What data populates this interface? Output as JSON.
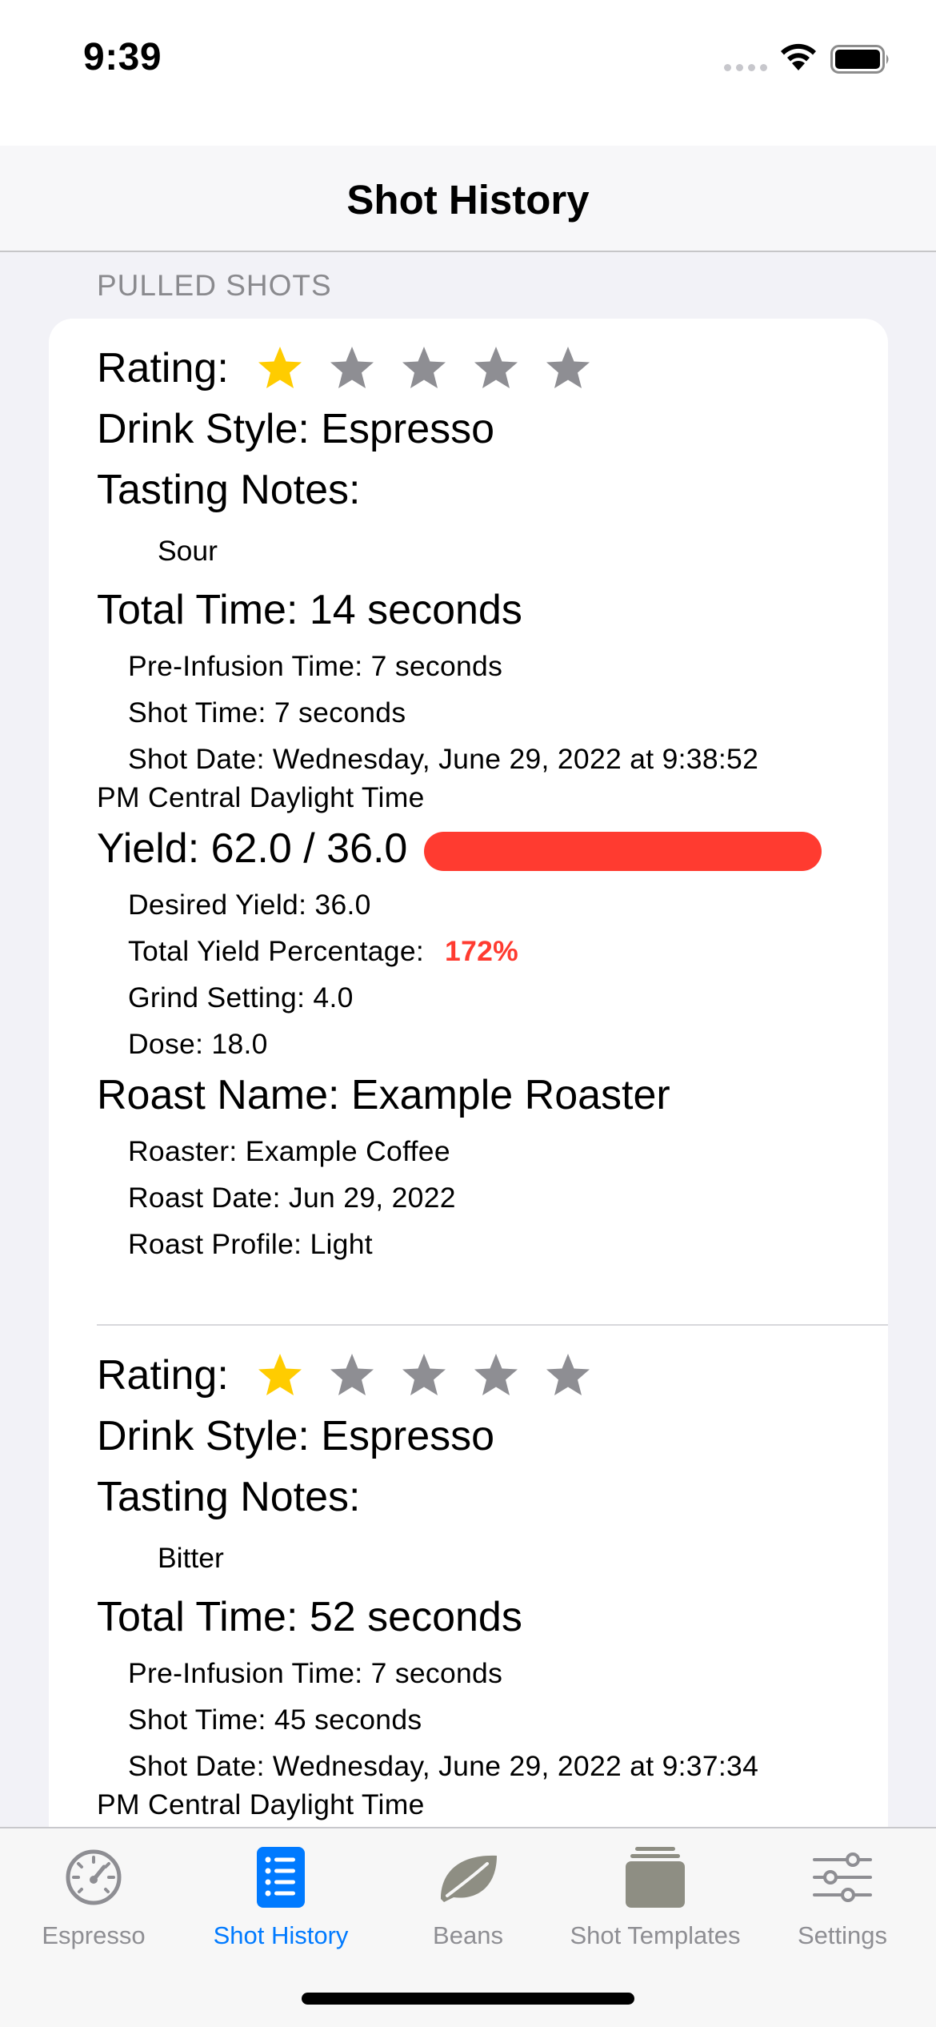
{
  "status_bar": {
    "time": "9:39"
  },
  "nav": {
    "title": "Shot History"
  },
  "section": {
    "header": "PULLED SHOTS"
  },
  "rating_label": "Rating:",
  "shots": [
    {
      "rating": 1,
      "rating_max": 5,
      "drink_style": "Drink Style: Espresso",
      "tasting_notes_label": "Tasting Notes:",
      "tasting_note": "Sour",
      "total_time": "Total Time: 14 seconds",
      "pre_infusion": "Pre-Infusion Time: 7 seconds",
      "shot_time": "Shot Time: 7 seconds",
      "shot_date_line1": "Shot Date: Wednesday, June 29, 2022 at 9:38:52",
      "shot_date_line2": "PM Central Daylight Time",
      "yield": "Yield: 62.0 / 36.0",
      "yield_fraction": 1.0,
      "desired_yield": "Desired Yield: 36.0",
      "total_yield_pct_label": "Total Yield Percentage:",
      "total_yield_pct": "172%",
      "grind": "Grind Setting: 4.0",
      "dose": "Dose: 18.0",
      "roast_name": "Roast Name: Example Roaster",
      "roaster": "Roaster: Example Coffee",
      "roast_date": "Roast Date: Jun 29, 2022",
      "roast_profile": "Roast Profile: Light"
    },
    {
      "rating": 1,
      "rating_max": 5,
      "drink_style": "Drink Style: Espresso",
      "tasting_notes_label": "Tasting Notes:",
      "tasting_note": "Bitter",
      "total_time": "Total Time: 52 seconds",
      "pre_infusion": "Pre-Infusion Time: 7 seconds",
      "shot_time": "Shot Time: 45 seconds",
      "shot_date_line1": "Shot Date: Wednesday, June 29, 2022 at 9:37:34",
      "shot_date_line2": "PM Central Daylight Time"
    }
  ],
  "tabs": [
    {
      "label": "Espresso",
      "icon": "gauge-icon",
      "active": false
    },
    {
      "label": "Shot History",
      "icon": "list-icon",
      "active": true
    },
    {
      "label": "Beans",
      "icon": "leaf-icon",
      "active": false
    },
    {
      "label": "Shot Templates",
      "icon": "stack-icon",
      "active": false
    },
    {
      "label": "Settings",
      "icon": "sliders-icon",
      "active": false
    }
  ],
  "colors": {
    "accent": "#007aff",
    "star_filled": "#ffcc00",
    "star_empty": "#8e8e93",
    "warning": "#ff3b30",
    "tab_inactive": "#8e8e93"
  }
}
